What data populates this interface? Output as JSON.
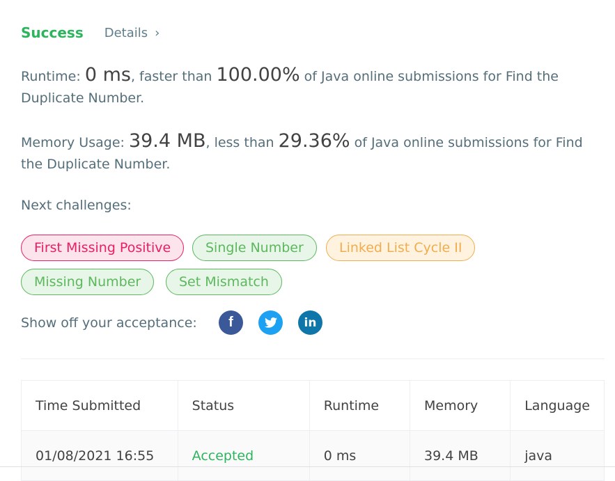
{
  "header": {
    "success": "Success",
    "details": "Details",
    "chevron": "›"
  },
  "runtime": {
    "label": "Runtime: ",
    "value": "0 ms",
    "mid": ", faster than ",
    "percent": "100.00%",
    "suffix": " of Java online submissions for Find the Duplicate Number."
  },
  "memory": {
    "label": "Memory Usage: ",
    "value": "39.4 MB",
    "mid": ", less than ",
    "percent": "29.36%",
    "suffix": " of Java online submissions for Find the Duplicate Number."
  },
  "next_label": "Next challenges:",
  "challenges": [
    {
      "label": "First Missing Positive",
      "difficulty": "hard"
    },
    {
      "label": "Single Number",
      "difficulty": "easy"
    },
    {
      "label": "Linked List Cycle II",
      "difficulty": "medium"
    },
    {
      "label": "Missing Number",
      "difficulty": "easy"
    },
    {
      "label": "Set Mismatch",
      "difficulty": "easy"
    }
  ],
  "share_label": "Show off your acceptance:",
  "social": {
    "facebook": {
      "icon": "facebook-icon",
      "glyph": "f",
      "color": "#3b5998"
    },
    "twitter": {
      "icon": "twitter-icon",
      "color": "#1da1f2"
    },
    "linkedin": {
      "icon": "linkedin-icon",
      "glyph": "in",
      "color": "#0e76a8"
    }
  },
  "table": {
    "headers": [
      "Time Submitted",
      "Status",
      "Runtime",
      "Memory",
      "Language"
    ],
    "rows": [
      [
        "01/08/2021 16:55",
        "Accepted",
        "0 ms",
        "39.4 MB",
        "java"
      ]
    ]
  },
  "colors": {
    "success": "#2db55d",
    "hard": "#e91e63",
    "easy": "#5cb85c",
    "medium": "#f0ad4e"
  }
}
